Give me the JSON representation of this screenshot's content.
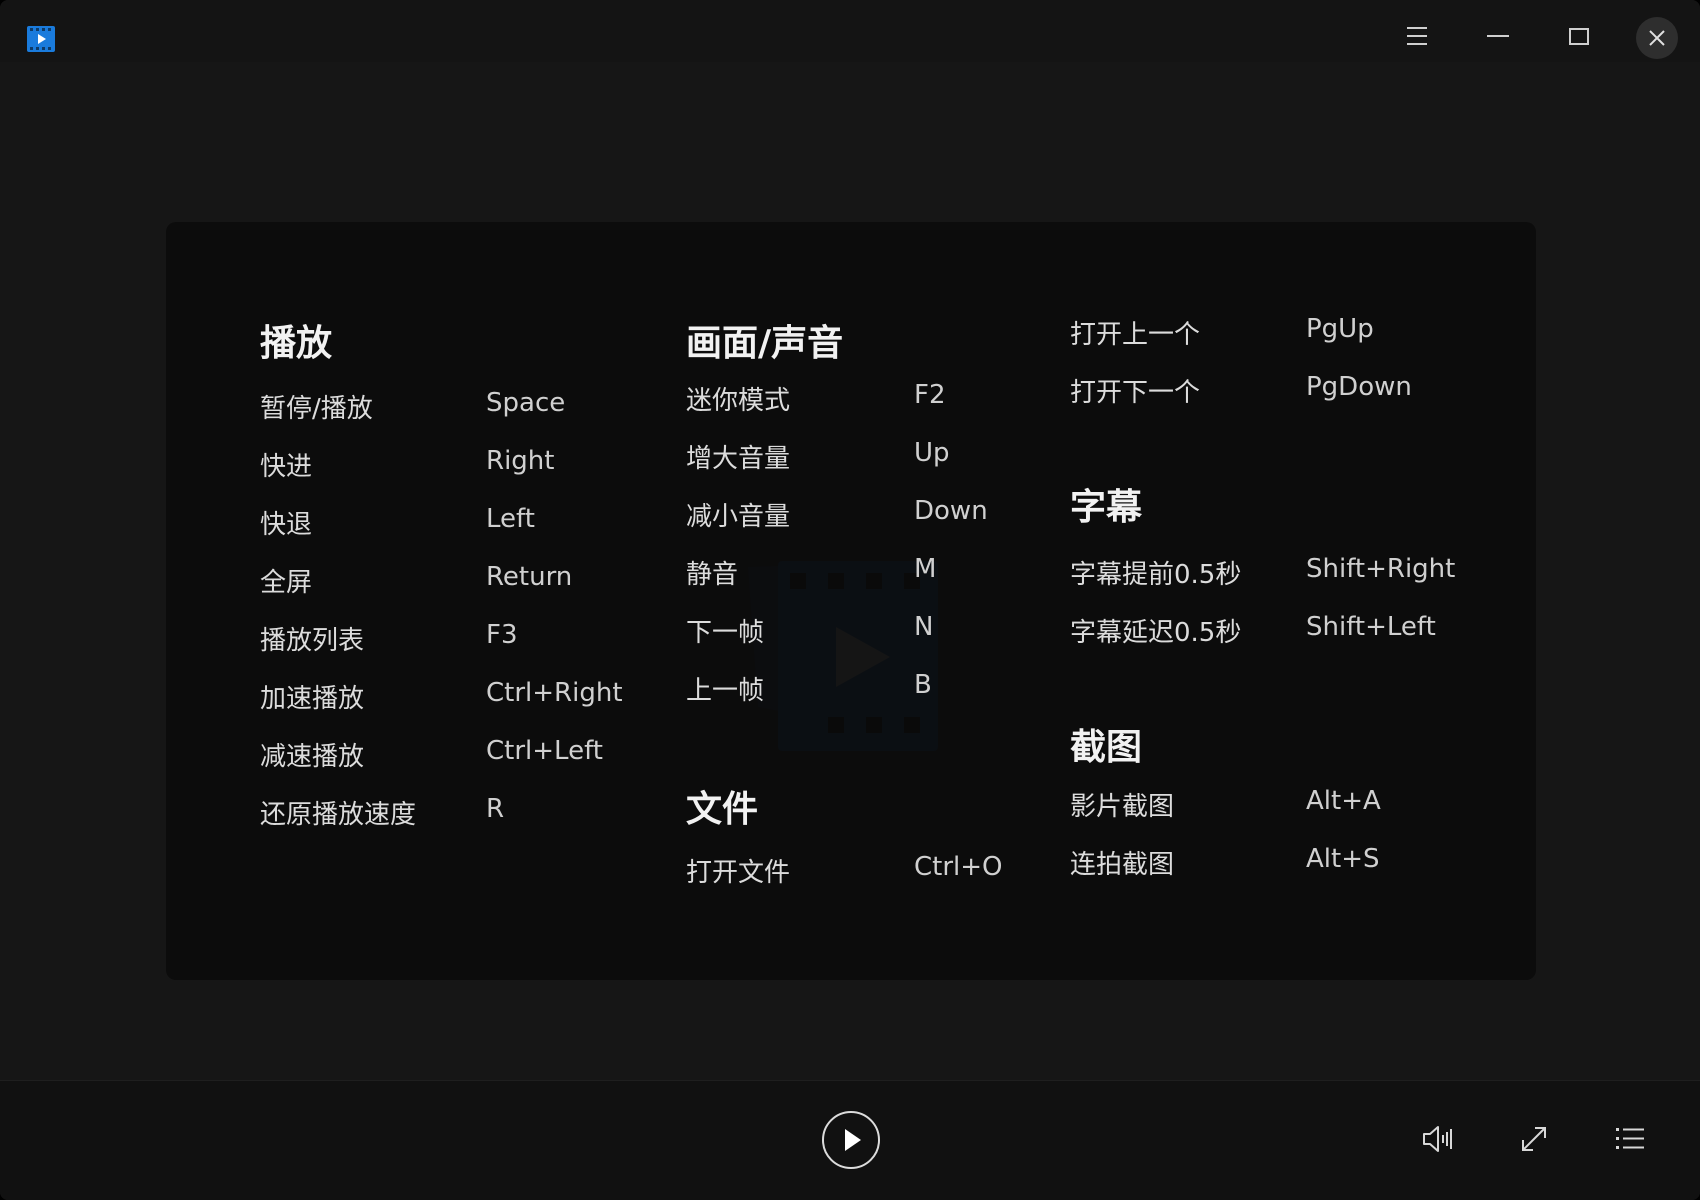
{
  "colors": {
    "accent": "#1a7bdc",
    "panel_bg": "#0a0a0a",
    "window_bg": "#161616"
  },
  "titlebar": {
    "icons": [
      "app-logo-icon",
      "menu-icon",
      "minimize-icon",
      "maximize-icon",
      "close-icon"
    ]
  },
  "shortcuts": {
    "playback": {
      "title": "播放",
      "items": [
        {
          "label": "暂停/播放",
          "key": "Space"
        },
        {
          "label": "快进",
          "key": "Right"
        },
        {
          "label": "快退",
          "key": "Left"
        },
        {
          "label": "全屏",
          "key": "Return"
        },
        {
          "label": "播放列表",
          "key": "F3"
        },
        {
          "label": "加速播放",
          "key": "Ctrl+Right"
        },
        {
          "label": "减速播放",
          "key": "Ctrl+Left"
        },
        {
          "label": "还原播放速度",
          "key": "R"
        }
      ]
    },
    "picture_sound": {
      "title": "画面/声音",
      "items": [
        {
          "label": "迷你模式",
          "key": "F2"
        },
        {
          "label": "增大音量",
          "key": "Up"
        },
        {
          "label": "减小音量",
          "key": "Down"
        },
        {
          "label": "静音",
          "key": "M"
        },
        {
          "label": "下一帧",
          "key": "N"
        },
        {
          "label": "上一帧",
          "key": "B"
        }
      ]
    },
    "file": {
      "title": "文件",
      "items": [
        {
          "label": "打开文件",
          "key": "Ctrl+O"
        }
      ]
    },
    "navigation": {
      "items": [
        {
          "label": "打开上一个",
          "key": "PgUp"
        },
        {
          "label": "打开下一个",
          "key": "PgDown"
        }
      ]
    },
    "subtitle": {
      "title": "字幕",
      "items": [
        {
          "label": "字幕提前0.5秒",
          "key": "Shift+Right"
        },
        {
          "label": "字幕延迟0.5秒",
          "key": "Shift+Left"
        }
      ]
    },
    "screenshot": {
      "title": "截图",
      "items": [
        {
          "label": "影片截图",
          "key": "Alt+A"
        },
        {
          "label": "连拍截图",
          "key": "Alt+S"
        }
      ]
    }
  },
  "bottombar": {
    "icons": [
      "play-icon",
      "volume-icon",
      "fullscreen-icon",
      "playlist-icon"
    ]
  }
}
